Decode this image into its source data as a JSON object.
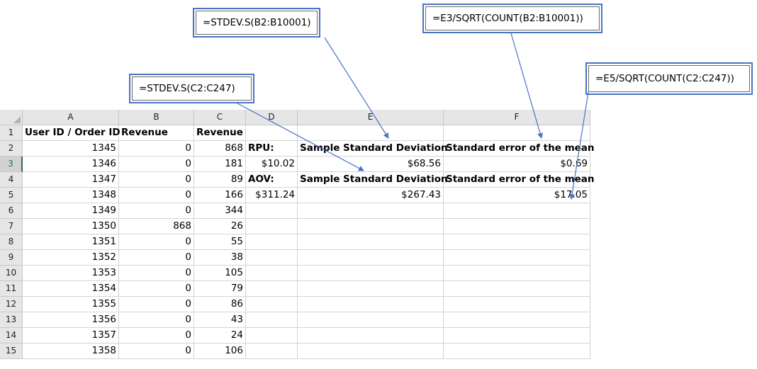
{
  "callouts": {
    "stdev_b": "=STDEV.S(B2:B10001)",
    "sem_b": "=E3/SQRT(COUNT(B2:B10001))",
    "stdev_c": "=STDEV.S(C2:C247)",
    "sem_c": "=E5/SQRT(COUNT(C2:C247))"
  },
  "sheet": {
    "columns": [
      "A",
      "B",
      "C",
      "D",
      "E",
      "F"
    ],
    "active_row": 3,
    "rows": [
      {
        "n": "1",
        "A": "User ID / Order ID",
        "B": "Revenue",
        "C": "Revenue",
        "D": "",
        "E": "",
        "F": ""
      },
      {
        "n": "2",
        "A": "1345",
        "B": "0",
        "C": "868",
        "D": "RPU:",
        "E": "Sample Standard Deviation",
        "F": "Standard error of the mean"
      },
      {
        "n": "3",
        "A": "1346",
        "B": "0",
        "C": "181",
        "D": "$10.02",
        "E": "$68.56",
        "F": "$0.69"
      },
      {
        "n": "4",
        "A": "1347",
        "B": "0",
        "C": "89",
        "D": "AOV:",
        "E": "Sample Standard Deviation",
        "F": "Standard error of the mean"
      },
      {
        "n": "5",
        "A": "1348",
        "B": "0",
        "C": "166",
        "D": "$311.24",
        "E": "$267.43",
        "F": "$17.05"
      },
      {
        "n": "6",
        "A": "1349",
        "B": "0",
        "C": "344",
        "D": "",
        "E": "",
        "F": ""
      },
      {
        "n": "7",
        "A": "1350",
        "B": "868",
        "C": "26",
        "D": "",
        "E": "",
        "F": ""
      },
      {
        "n": "8",
        "A": "1351",
        "B": "0",
        "C": "55",
        "D": "",
        "E": "",
        "F": ""
      },
      {
        "n": "9",
        "A": "1352",
        "B": "0",
        "C": "38",
        "D": "",
        "E": "",
        "F": ""
      },
      {
        "n": "10",
        "A": "1353",
        "B": "0",
        "C": "105",
        "D": "",
        "E": "",
        "F": ""
      },
      {
        "n": "11",
        "A": "1354",
        "B": "0",
        "C": "79",
        "D": "",
        "E": "",
        "F": ""
      },
      {
        "n": "12",
        "A": "1355",
        "B": "0",
        "C": "86",
        "D": "",
        "E": "",
        "F": ""
      },
      {
        "n": "13",
        "A": "1356",
        "B": "0",
        "C": "43",
        "D": "",
        "E": "",
        "F": ""
      },
      {
        "n": "14",
        "A": "1357",
        "B": "0",
        "C": "24",
        "D": "",
        "E": "",
        "F": ""
      },
      {
        "n": "15",
        "A": "1358",
        "B": "0",
        "C": "106",
        "D": "",
        "E": "",
        "F": ""
      }
    ]
  },
  "colors": {
    "arrow": "#4a72c4",
    "header_bg": "#e6e6e6",
    "gridline": "#d4d4d4",
    "active": "#217346"
  }
}
